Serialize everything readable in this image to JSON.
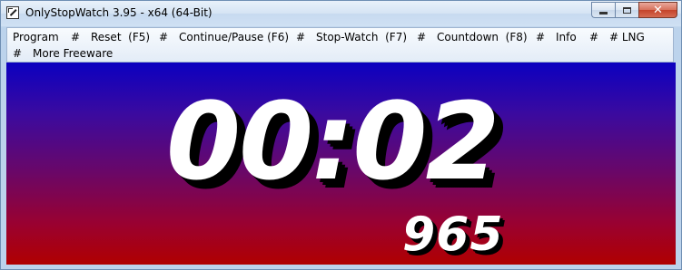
{
  "window": {
    "title": "OnlyStopWatch 3.95 - x64 (64-Bit)",
    "app_icon": "stopwatch-app-icon",
    "controls": {
      "minimize": "minimize-icon",
      "maximize": "maximize-icon",
      "close": "close-icon",
      "close_glyph": "✕"
    }
  },
  "menu": {
    "separator": "#",
    "items": [
      {
        "label": "Program"
      },
      {
        "label": "Reset  (F5)"
      },
      {
        "label": "Continue/Pause (F6)"
      },
      {
        "label": "Stop-Watch  (F7)"
      },
      {
        "label": "Countdown  (F8)"
      },
      {
        "label": "Info"
      },
      {
        "label": "# LNG"
      },
      {
        "label": "More Freeware"
      }
    ]
  },
  "display": {
    "time": "00:02",
    "milliseconds": "965",
    "colors": {
      "top": "#0c00c0",
      "bottom": "#b00000",
      "digits": "#ffffff",
      "shadow": "#000000"
    }
  }
}
